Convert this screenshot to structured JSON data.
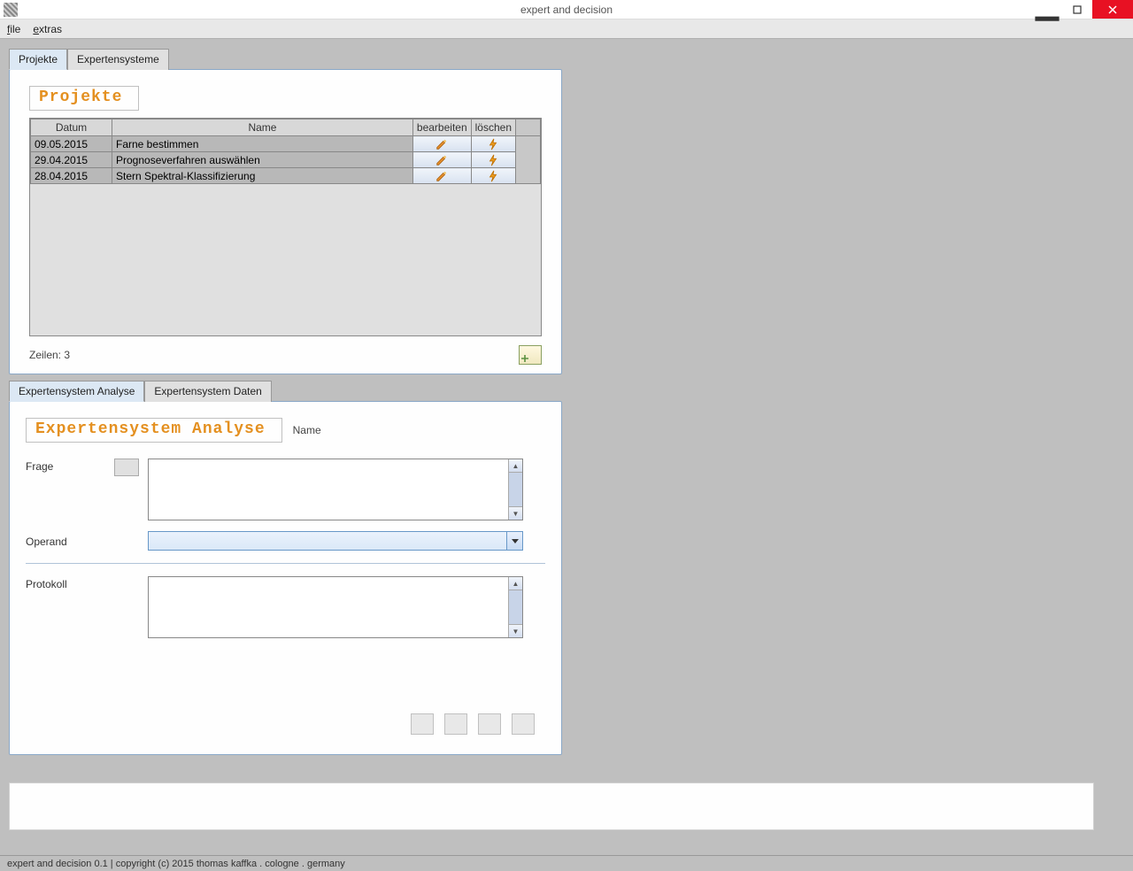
{
  "window": {
    "title": "expert and decision"
  },
  "menubar": {
    "file": "file",
    "extras": "extras"
  },
  "upper_tabs": {
    "tab1": "Projekte",
    "tab2": "Expertensysteme"
  },
  "projekte": {
    "heading": "Projekte",
    "columns": {
      "date": "Datum",
      "name": "Name",
      "edit": "bearbeiten",
      "del": "löschen"
    },
    "rows": [
      {
        "date": "09.05.2015",
        "name": "Farne bestimmen"
      },
      {
        "date": "29.04.2015",
        "name": "Prognoseverfahren auswählen"
      },
      {
        "date": "28.04.2015",
        "name": "Stern Spektral-Klassifizierung"
      }
    ],
    "rowcount_label": "Zeilen: 3"
  },
  "lower_tabs": {
    "tab1": "Expertensystem Analyse",
    "tab2": "Expertensystem Daten"
  },
  "analyse": {
    "heading": "Expertensystem Analyse",
    "name_label": "Name",
    "frage_label": "Frage",
    "operand_label": "Operand",
    "protokoll_label": "Protokoll"
  },
  "footer": {
    "text": "expert and decision 0.1 | copyright (c) 2015 thomas kaffka . cologne . germany"
  }
}
